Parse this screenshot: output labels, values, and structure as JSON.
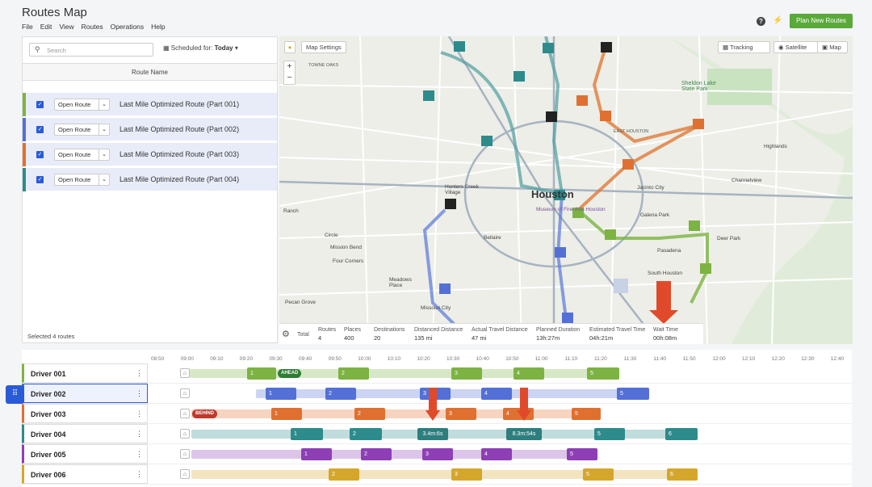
{
  "app": {
    "title": "Routes Map",
    "menu": [
      "File",
      "Edit",
      "View",
      "Routes",
      "Operations",
      "Help"
    ],
    "plan_button": "Plan New Routes",
    "help_icon": "?",
    "bolt_icon": "⚡"
  },
  "left": {
    "search_placeholder": "Search",
    "scheduled_prefix": "Scheduled for:",
    "scheduled_value": "Today",
    "column_header": "Route Name",
    "open_label": "Open Route",
    "routes": [
      {
        "name": "Last Mile Optimized Route (Part 001)",
        "color": "#7cb342"
      },
      {
        "name": "Last Mile Optimized Route (Part 002)",
        "color": "#5470d6"
      },
      {
        "name": "Last Mile Optimized Route (Part 003)",
        "color": "#e07030"
      },
      {
        "name": "Last Mile Optimized Route (Part 004)",
        "color": "#2e8b8b"
      }
    ],
    "selected_count": "Selected 4 routes"
  },
  "map": {
    "settings": "Map Settings",
    "tracking": "Tracking",
    "satellite": "Satellite",
    "map_btn": "Map",
    "zoom_in": "+",
    "zoom_out": "−",
    "labels": [
      "Houston",
      "TOWNE OAKS",
      "Sheldon Lake State Park",
      "Channelview",
      "Highlands",
      "Galena Park",
      "Jacinto City",
      "Pasadena",
      "Deer Park",
      "South Houston",
      "Bellaire",
      "Meadows Place",
      "Mission Bend",
      "Four Corners",
      "Missouri City",
      "Pecan Grove",
      "Ranch",
      "Circle",
      "Hunters Creek Village",
      "Museum of Fine Arts Houston",
      "EAST HOUSTON"
    ],
    "stats": {
      "total": "Total",
      "routes_label": "Routes",
      "routes": "4",
      "places_label": "Places",
      "places": "400",
      "dest_label": "Destinations",
      "dest": "20",
      "dist_label": "Distanced Distance",
      "dist": "135 mi",
      "actual_label": "Actual Travel Distance",
      "actual": "47 mi",
      "planned_label": "Planned Duration",
      "planned": "13h:27m",
      "est_label": "Estimated Travel Time",
      "est": "04h:21m",
      "wait_label": "Wait Time",
      "wait": "00h:08m"
    }
  },
  "timeline": {
    "ticks": [
      "08:50",
      "09:00",
      "09:10",
      "09:20",
      "09:30",
      "09:40",
      "09:50",
      "10:00",
      "10:10",
      "10:20",
      "10:30",
      "10:40",
      "10:50",
      "11:00",
      "11:10",
      "11:20",
      "11:30",
      "11:40",
      "11:50",
      "12:00",
      "12:10",
      "12:20",
      "12:30",
      "12:40"
    ],
    "drivers": [
      {
        "name": "Driver 001",
        "color": "#7cb342"
      },
      {
        "name": "Driver 002",
        "color": "#5470d6"
      },
      {
        "name": "Driver 003",
        "color": "#e07030"
      },
      {
        "name": "Driver 004",
        "color": "#2e8b8b"
      },
      {
        "name": "Driver 005",
        "color": "#8e3fb5"
      },
      {
        "name": "Driver 006",
        "color": "#d4a72c"
      }
    ],
    "ahead": "AHEAD",
    "behind": "BEHIND",
    "delay1": "3.4m:6s",
    "delay2": "8.3m:54s"
  }
}
